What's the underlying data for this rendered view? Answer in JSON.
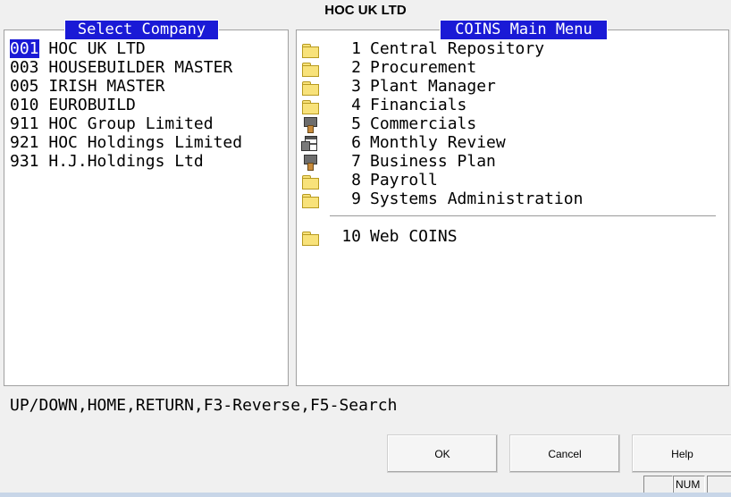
{
  "window": {
    "title": "HOC UK LTD"
  },
  "company_panel": {
    "header": "Select Company",
    "selected_index": 0,
    "companies": [
      {
        "code": "001",
        "name": "HOC UK LTD"
      },
      {
        "code": "003",
        "name": "HOUSEBUILDER MASTER"
      },
      {
        "code": "005",
        "name": "IRISH MASTER"
      },
      {
        "code": "010",
        "name": "EUROBUILD"
      },
      {
        "code": "911",
        "name": "HOC Group Limited"
      },
      {
        "code": "921",
        "name": "HOC Holdings Limited"
      },
      {
        "code": "931",
        "name": "H.J.Holdings Ltd"
      }
    ]
  },
  "menu_panel": {
    "header": "COINS Main Menu",
    "items": [
      {
        "num": "1",
        "label": "Central Repository",
        "icon": "folder-icon"
      },
      {
        "num": "2",
        "label": "Procurement",
        "icon": "folder-icon"
      },
      {
        "num": "3",
        "label": "Plant Manager",
        "icon": "folder-icon"
      },
      {
        "num": "4",
        "label": "Financials",
        "icon": "folder-icon"
      },
      {
        "num": "5",
        "label": "Commercials",
        "icon": "tool-icon"
      },
      {
        "num": "6",
        "label": "Monthly Review",
        "icon": "document-icon"
      },
      {
        "num": "7",
        "label": "Business Plan",
        "icon": "tool-icon"
      },
      {
        "num": "8",
        "label": "Payroll",
        "icon": "folder-icon"
      },
      {
        "num": "9",
        "label": "Systems Administration",
        "icon": "folder-icon"
      }
    ],
    "extra_item": {
      "num": "10",
      "label": "Web COINS",
      "icon": "folder-icon"
    }
  },
  "status_hint": "UP/DOWN,HOME,RETURN,F3-Reverse,F5-Search",
  "buttons": {
    "ok": "OK",
    "cancel": "Cancel",
    "help": "Help"
  },
  "status_bar": {
    "num_indicator": "NUM"
  },
  "colors": {
    "highlight": "#1a1ad6",
    "background": "#f0f0f0"
  }
}
